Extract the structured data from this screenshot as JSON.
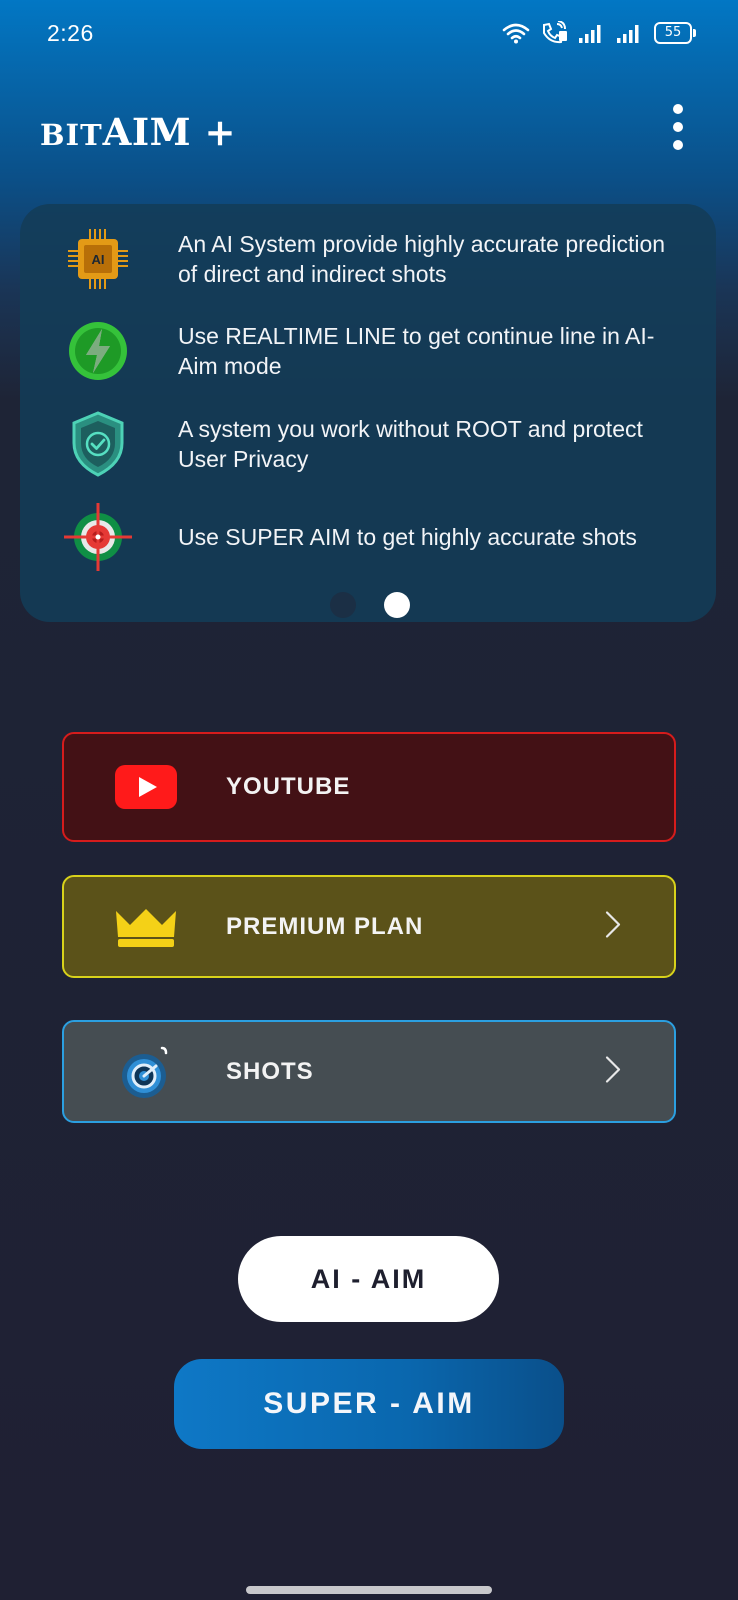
{
  "status_bar": {
    "time": "2:26",
    "battery": "55",
    "icons": [
      "wifi-icon",
      "volte-call-icon",
      "signal-icon",
      "signal-icon",
      "battery-icon"
    ]
  },
  "app_bar": {
    "title_small": "BIT",
    "title_large": "AIM +",
    "menu_icon": "more-vert-icon"
  },
  "feature_card": {
    "items": [
      {
        "icon": "ai-chip-icon",
        "text": "An AI System provide highly accurate prediction of direct and indirect shots"
      },
      {
        "icon": "lightning-icon",
        "text": "Use REALTIME LINE to get continue line in AI-Aim mode"
      },
      {
        "icon": "shield-check-icon",
        "text": "A system you work without ROOT and protect User Privacy"
      },
      {
        "icon": "crosshair-icon",
        "text": "Use SUPER AIM to get highly accurate shots"
      }
    ],
    "carousel": {
      "page_count": 2,
      "active_page": 2
    }
  },
  "menu": {
    "youtube": {
      "label": "YOUTUBE",
      "icon": "youtube-icon"
    },
    "premium": {
      "label": "PREMIUM PLAN",
      "icon": "crown-icon"
    },
    "shots": {
      "label": "SHOTS",
      "icon": "camera-shutter-icon"
    }
  },
  "actions": {
    "ai_aim": "AI - AIM",
    "super_aim": "SUPER - AIM"
  },
  "colors": {
    "youtube_border": "#d61c1c",
    "premium_border": "#d8d21b",
    "shots_border": "#2b9fe0",
    "accent_blue": "#0b6cb5"
  }
}
